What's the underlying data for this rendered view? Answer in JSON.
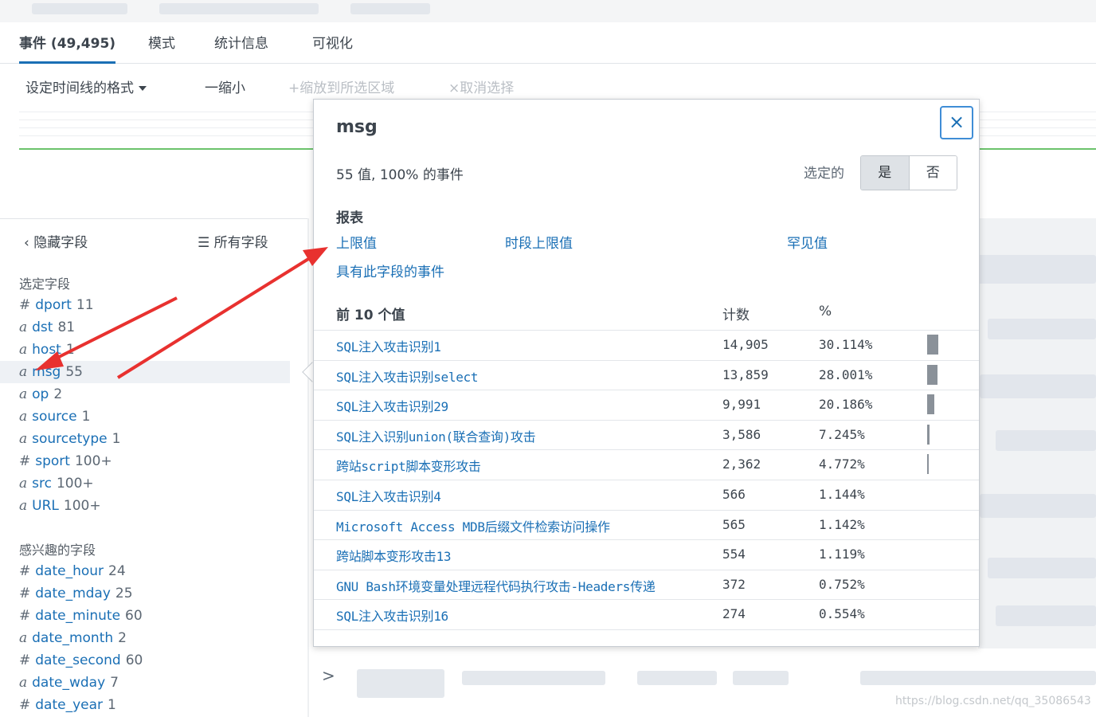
{
  "tabs": [
    {
      "label": "事件 (49,495)",
      "active": true
    },
    {
      "label": "模式",
      "active": false
    },
    {
      "label": "统计信息",
      "active": false
    },
    {
      "label": "可视化",
      "active": false
    }
  ],
  "timeline": {
    "format_label": "设定时间线的格式",
    "zoom_out_label": "一缩小",
    "zoom_selection_label": "+缩放到所选区域",
    "deselect_label": "×取消选择"
  },
  "sidebar": {
    "hide_fields_label": "隐藏字段",
    "all_fields_label": "所有字段",
    "selected_title": "选定字段",
    "selected_fields": [
      {
        "type": "#",
        "name": "dport",
        "count": "11"
      },
      {
        "type": "a",
        "name": "dst",
        "count": "81"
      },
      {
        "type": "a",
        "name": "host",
        "count": "1"
      },
      {
        "type": "a",
        "name": "msg",
        "count": "55"
      },
      {
        "type": "a",
        "name": "op",
        "count": "2"
      },
      {
        "type": "a",
        "name": "source",
        "count": "1"
      },
      {
        "type": "a",
        "name": "sourcetype",
        "count": "1"
      },
      {
        "type": "#",
        "name": "sport",
        "count": "100+"
      },
      {
        "type": "a",
        "name": "src",
        "count": "100+"
      },
      {
        "type": "a",
        "name": "URL",
        "count": "100+"
      }
    ],
    "interesting_title": "感兴趣的字段",
    "interesting_fields": [
      {
        "type": "#",
        "name": "date_hour",
        "count": "24"
      },
      {
        "type": "#",
        "name": "date_mday",
        "count": "25"
      },
      {
        "type": "#",
        "name": "date_minute",
        "count": "60"
      },
      {
        "type": "a",
        "name": "date_month",
        "count": "2"
      },
      {
        "type": "#",
        "name": "date_second",
        "count": "60"
      },
      {
        "type": "a",
        "name": "date_wday",
        "count": "7"
      },
      {
        "type": "#",
        "name": "date_year",
        "count": "1"
      }
    ]
  },
  "popover": {
    "title": "msg",
    "close_icon": "×",
    "summary": "55 值, 100% 的事件",
    "selected_label": "选定的",
    "toggle_yes": "是",
    "toggle_no": "否",
    "reports_title": "报表",
    "report_links": [
      "上限值",
      "时段上限值",
      "罕见值",
      "具有此字段的事件"
    ],
    "table_header": {
      "value": "前 10 个值",
      "count": "计数",
      "percent": "%"
    },
    "rows": [
      {
        "value": "SQL注入攻击识别1",
        "count": "14,905",
        "percent": "30.114%",
        "pct_num": 30.114
      },
      {
        "value": "SQL注入攻击识别select",
        "count": "13,859",
        "percent": "28.001%",
        "pct_num": 28.001
      },
      {
        "value": "SQL注入攻击识别29",
        "count": "9,991",
        "percent": "20.186%",
        "pct_num": 20.186
      },
      {
        "value": "SQL注入识别union(联合查询)攻击",
        "count": "3,586",
        "percent": "7.245%",
        "pct_num": 7.245
      },
      {
        "value": "跨站script脚本变形攻击",
        "count": "2,362",
        "percent": "4.772%",
        "pct_num": 4.772
      },
      {
        "value": "SQL注入攻击识别4",
        "count": "566",
        "percent": "1.144%",
        "pct_num": 1.144
      },
      {
        "value": "Microsoft Access MDB后缀文件检索访问操作",
        "count": "565",
        "percent": "1.142%",
        "pct_num": 1.142
      },
      {
        "value": "跨站脚本变形攻击13",
        "count": "554",
        "percent": "1.119%",
        "pct_num": 1.119
      },
      {
        "value": "GNU Bash环境变量处理远程代码执行攻击-Headers传递",
        "count": "372",
        "percent": "0.752%",
        "pct_num": 0.752
      },
      {
        "value": "SQL注入攻击识别16",
        "count": "274",
        "percent": "0.554%",
        "pct_num": 0.554
      }
    ]
  },
  "bottom": {
    "expand_icon": ">",
    "watermark": "https://blog.csdn.net/qq_35086543"
  },
  "colors": {
    "accent": "#1a6fb5",
    "annotation": "#e8312f",
    "timeline_green": "#6cc36c"
  }
}
